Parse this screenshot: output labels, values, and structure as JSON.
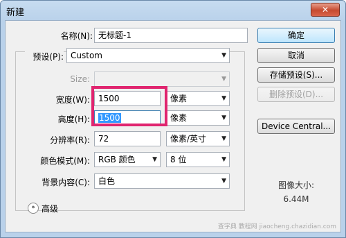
{
  "window": {
    "title": "新建",
    "close_label": "✕"
  },
  "form": {
    "name_label": "名称(N):",
    "name_value": "无标题-1",
    "preset_label": "预设(P):",
    "preset_value": "Custom",
    "size_label": "Size:",
    "size_value": "",
    "width_label": "宽度(W):",
    "width_value": "1500",
    "width_unit": "像素",
    "height_label": "高度(H):",
    "height_value": "1500",
    "height_unit": "像素",
    "resolution_label": "分辨率(R):",
    "resolution_value": "72",
    "resolution_unit": "像素/英寸",
    "color_mode_label": "颜色模式(M):",
    "color_mode_value": "RGB 颜色",
    "bit_depth_value": "8 位",
    "background_label": "背景内容(C):",
    "background_value": "白色",
    "advanced_label": "高级"
  },
  "buttons": {
    "ok": "确定",
    "cancel": "取消",
    "save_preset": "存储预设(S)...",
    "delete_preset": "删除预设(D)...",
    "device_central": "Device Central..."
  },
  "image_size": {
    "label": "图像大小:",
    "value": "6.44M"
  },
  "watermark": "查字典 教程网 jiaocheng.chazidian.com",
  "colors": {
    "highlight": "#e0256f",
    "selection": "#3399ff"
  }
}
